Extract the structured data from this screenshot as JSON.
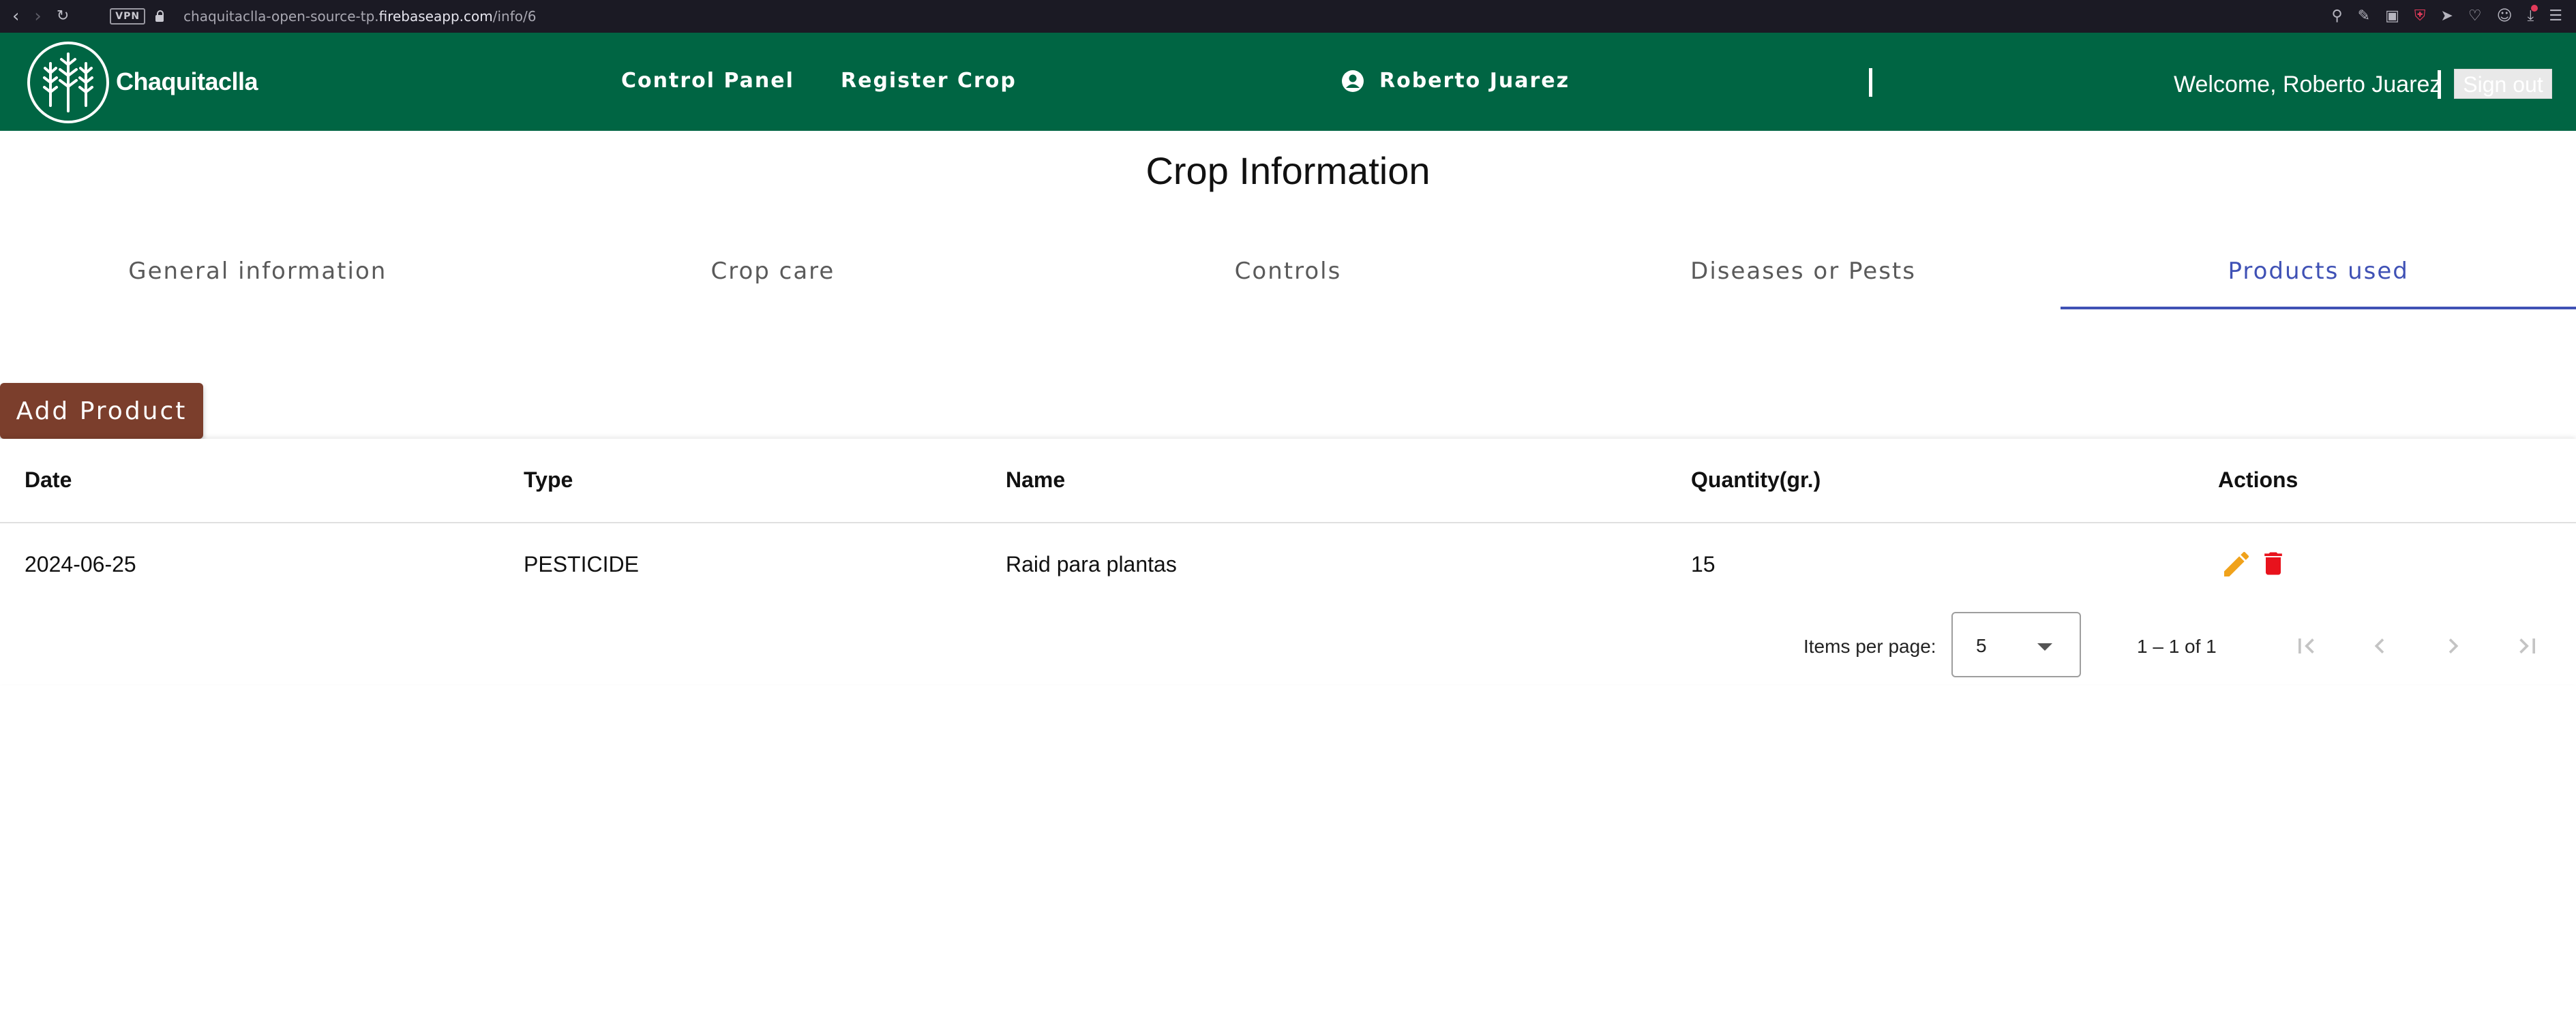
{
  "browser": {
    "vpn_label": "VPN",
    "url_prefix": "chaquitaclla-open-source-tp.",
    "url_domain": "firebaseapp.com",
    "url_path": "/info/6",
    "icons": [
      "back-icon",
      "forward-icon",
      "reload-icon",
      "lock-icon",
      "search-icon",
      "edit-icon",
      "camera-icon",
      "shield-icon",
      "send-icon",
      "heart-icon",
      "profile-icon",
      "download-icon",
      "menu-icon"
    ]
  },
  "header": {
    "brand": "Chaquitaclla",
    "nav": {
      "control_panel": "Control Panel",
      "register_crop": "Register Crop"
    },
    "user_name": "Roberto Juarez",
    "welcome": "Welcome, Roberto Juarez",
    "sign_out": "Sign out",
    "colors": {
      "bar": "#006543"
    }
  },
  "page": {
    "title": "Crop Information"
  },
  "tabs": [
    {
      "label": "General information",
      "active": false
    },
    {
      "label": "Crop care",
      "active": false
    },
    {
      "label": "Controls",
      "active": false
    },
    {
      "label": "Diseases or Pests",
      "active": false
    },
    {
      "label": "Products used",
      "active": true
    }
  ],
  "accent_color": "#3f51b5",
  "add_button": {
    "label": "Add Product",
    "color": "#7b3e2c"
  },
  "table": {
    "columns": [
      "Date",
      "Type",
      "Name",
      "Quantity(gr.)",
      "Actions"
    ],
    "rows": [
      {
        "date": "2024-06-25",
        "type": "PESTICIDE",
        "name": "Raid para plantas",
        "quantity": "15",
        "actions": [
          "edit-icon",
          "trash-icon"
        ]
      }
    ]
  },
  "paginator": {
    "items_per_page_label": "Items per page:",
    "items_per_page": "5",
    "range": "1 – 1 of 1"
  }
}
